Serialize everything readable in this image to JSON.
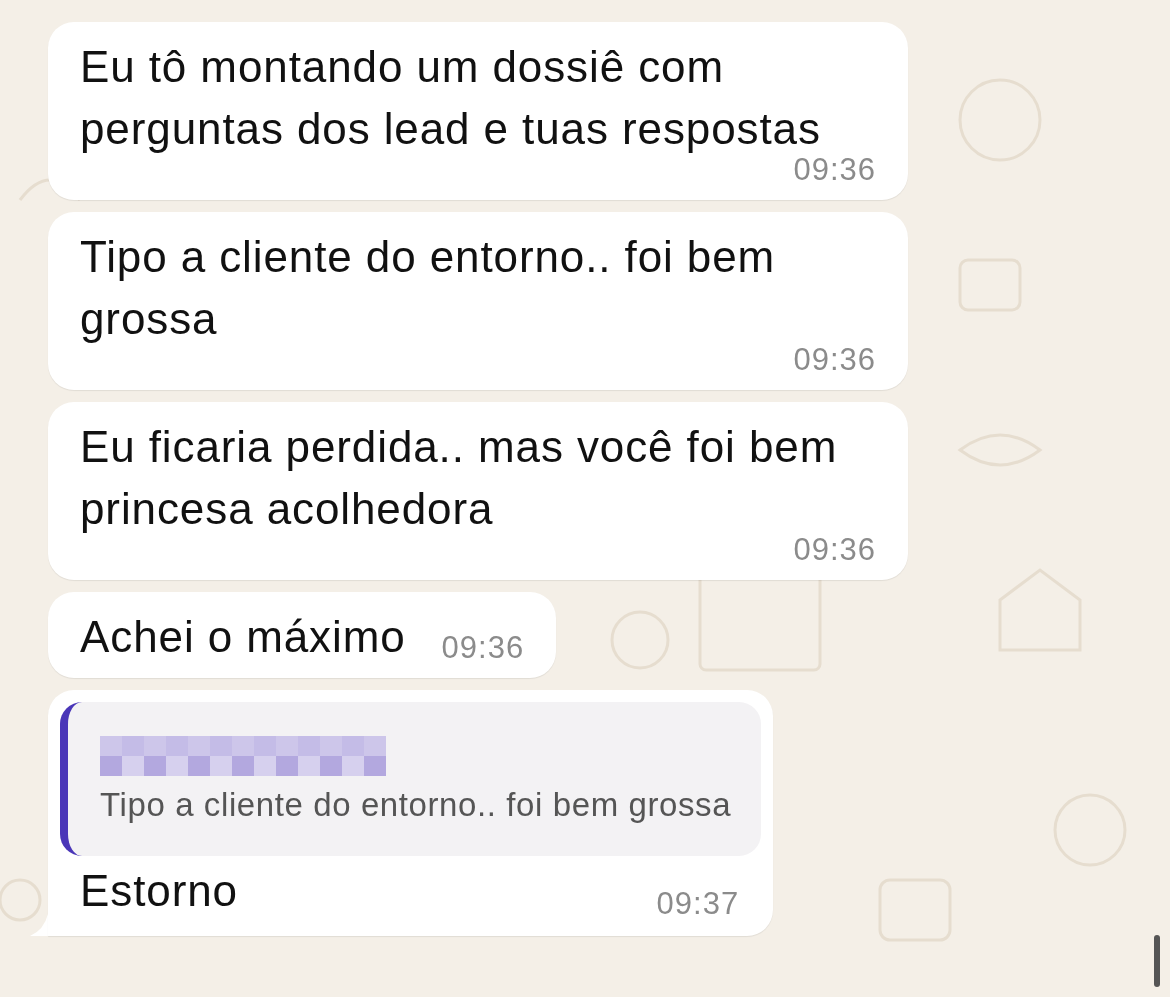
{
  "messages": [
    {
      "kind": "text",
      "text": "Eu tô montando um dossiê com perguntas dos lead e tuas respostas",
      "time": "09:36"
    },
    {
      "kind": "text",
      "text": "Tipo a cliente do entorno.. foi bem grossa",
      "time": "09:36"
    },
    {
      "kind": "text",
      "text": "Eu ficaria perdida.. mas você foi bem princesa acolhedora",
      "time": "09:36"
    },
    {
      "kind": "text",
      "text": "Achei o máximo",
      "time": "09:36"
    },
    {
      "kind": "reply",
      "quote": {
        "text": "Tipo a cliente do entorno.. foi bem grossa"
      },
      "text": "Estorno",
      "time": "09:37"
    }
  ]
}
